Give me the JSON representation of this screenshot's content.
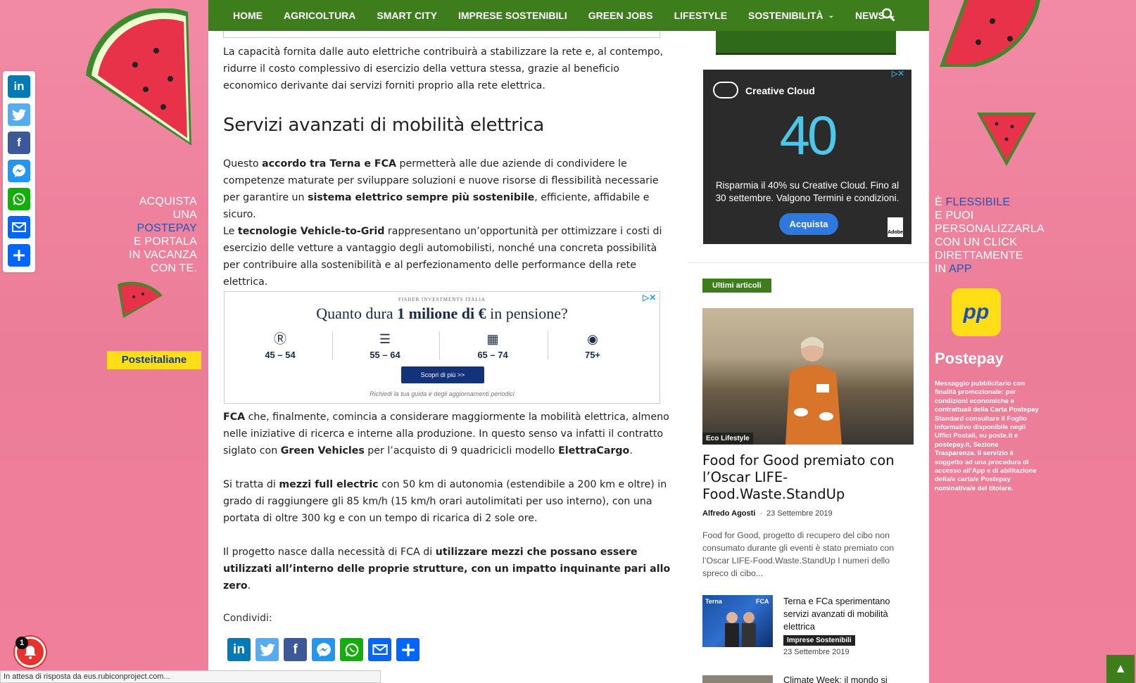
{
  "nav": {
    "items": [
      {
        "label": "HOME",
        "dropdown": false
      },
      {
        "label": "AGRICOLTURA",
        "dropdown": false
      },
      {
        "label": "SMART CITY",
        "dropdown": false
      },
      {
        "label": "IMPRESE SOSTENIBILI",
        "dropdown": false
      },
      {
        "label": "GREEN JOBS",
        "dropdown": false
      },
      {
        "label": "LIFESTYLE",
        "dropdown": false
      },
      {
        "label": "SOSTENIBILITÀ",
        "dropdown": true
      },
      {
        "label": "NEWS",
        "dropdown": true
      }
    ]
  },
  "skin_left": {
    "line1": "ACQUISTA UNA",
    "line2": "POSTEPAY",
    "line3": "E PORTALA",
    "line4": "IN VACANZA",
    "line5": "CON TE.",
    "logo": "Posteitaliane"
  },
  "skin_right": {
    "line1a": "È ",
    "line1b": "FLESSIBILE",
    "line2": "E PUOI",
    "line3": "PERSONALIZZARLA",
    "line4": "CON UN CLICK",
    "line5": "DIRETTAMENTE",
    "line6a": "IN ",
    "line6b": "APP",
    "badge": "pp",
    "brand": "Postepay",
    "disclaimer": "Messaggio pubblicitario con finalità promozionale: per condizioni economiche e contrattuali della Carta Postepay Standard consultare il Foglio Informativo disponibile negli Uffici Postali, su poste.it e postepay.it, Sezione Trasparenza. Il servizio è soggetto ad una procedura di accesso all'App e di abilitazione della/e carta/e Postepay nominativa/e del titolare."
  },
  "article": {
    "p1": "La capacità fornita dalle auto elettriche contribuirà a stabilizzare la rete e, al contempo, ridurre il costo complessivo di esercizio della vettura stessa, grazie al beneficio economico derivante dai servizi forniti proprio alla rete elettrica.",
    "heading": "Servizi avanzati di mobilità elettrica",
    "p2": {
      "t1": "Questo ",
      "b1": "accordo tra Terna e FCA",
      "t2": " permetterà alle due aziende di condividere le competenze maturate per sviluppare soluzioni e nuove risorse di flessibilità necessarie per garantire un ",
      "b2": "sistema elettrico sempre più sostenibile",
      "t3": ", efficiente, affidabile e sicuro."
    },
    "p3": {
      "t1": "Le ",
      "b1": "tecnologie Vehicle-to-Grid",
      "t2": " rappresentano un’opportunità per ottimizzare i costi di esercizio delle vetture a vantaggio degli automobilisti, nonché una concreta possibilità per contribuire alla sostenibilità e al perfezionamento delle performance della rete elettrica."
    },
    "p4": {
      "b1": "FCA",
      "t1": " che, finalmente, comincia a considerare maggiormente la mobilità elettrica, almeno nelle iniziative di ricerca e interne alla produzione. In questo senso va infatti il contratto siglato con ",
      "b2": "Green Vehicles",
      "t2": " per l’acquisto di 9 quadricicli modello ",
      "b3": "ElettraCargo",
      "t3": "."
    },
    "p5": {
      "t1": "Si tratta di ",
      "b1": "mezzi full electric",
      "t2": " con 50 km di autonomia (estendibile a 200 km e oltre) in grado di raggiungere gli 85 km/h (15 km/h orari autolimitati per uso interno), con una portata di oltre 300 kg e con un tempo di ricarica di 2 sole ore."
    },
    "p6": {
      "t1": "Il progetto nasce dalla necessità di FCA di ",
      "b1": "utilizzare mezzi che possano essere utilizzati all’interno delle proprie strutture, con un impatto inquinante pari allo zero",
      "t2": "."
    },
    "share_label": "Condividi:"
  },
  "fisher_ad": {
    "brand": "FISHER INVESTMENTS ITALIA",
    "q1": "Quanto dura ",
    "q2": "1 milione di €",
    "q3": " in pensione?",
    "ages": [
      "45 – 54",
      "55 – 64",
      "65 – 74",
      "75+"
    ],
    "cta": "Scopri di più  >>",
    "note": "Richiedi la tua guida e degli aggiornamenti periodici"
  },
  "cc_ad": {
    "title": "Creative Cloud",
    "big": "40",
    "text": "Risparmia il 40% su Creative Cloud. Fino al 30 settembre. Valgono Termini e condizioni.",
    "cta": "Acquista",
    "adobe": "Adobe"
  },
  "sidebar": {
    "section_title": "Ultimi articoli",
    "featured": {
      "category": "Eco Lifestyle",
      "title": "Food for Good premiato con l’Oscar LIFE-Food.Waste.StandUp",
      "author": "Alfredo Agosti",
      "sep": "-",
      "date": "23 Settembre 2019",
      "excerpt": "Food for Good, progetto di recupero del cibo non consumato durante gli eventi è stato premiato con l’Oscar LIFE-Food.Waste.StandUp I numeri dello spreco di cibo..."
    },
    "items": [
      {
        "title": "Terna e FCa sperimentano servizi avanzati di mobilità elettrica",
        "category": "Imprese Sostenibili",
        "date": "23 Settembre 2019",
        "thumb_text1": "Terna",
        "thumb_text2": "FCA"
      },
      {
        "title": "Climate Week: il mondo si"
      }
    ]
  },
  "status_bar": "In attesa di risposta da eus.rubiconproject.com...",
  "notification_count": "1",
  "colors": {
    "nav_green": "#3d7d1c",
    "skin_pink": "#ee7f9c",
    "linkedin": "#007bb5",
    "twitter": "#55acee",
    "facebook": "#3b5998",
    "messenger": "#2196f3",
    "whatsapp": "#12af0a",
    "email": "#0166ff",
    "share": "#0166ff"
  },
  "share_icons": [
    "linkedin-icon",
    "twitter-icon",
    "facebook-icon",
    "messenger-icon",
    "whatsapp-icon",
    "email-icon",
    "share-icon"
  ]
}
